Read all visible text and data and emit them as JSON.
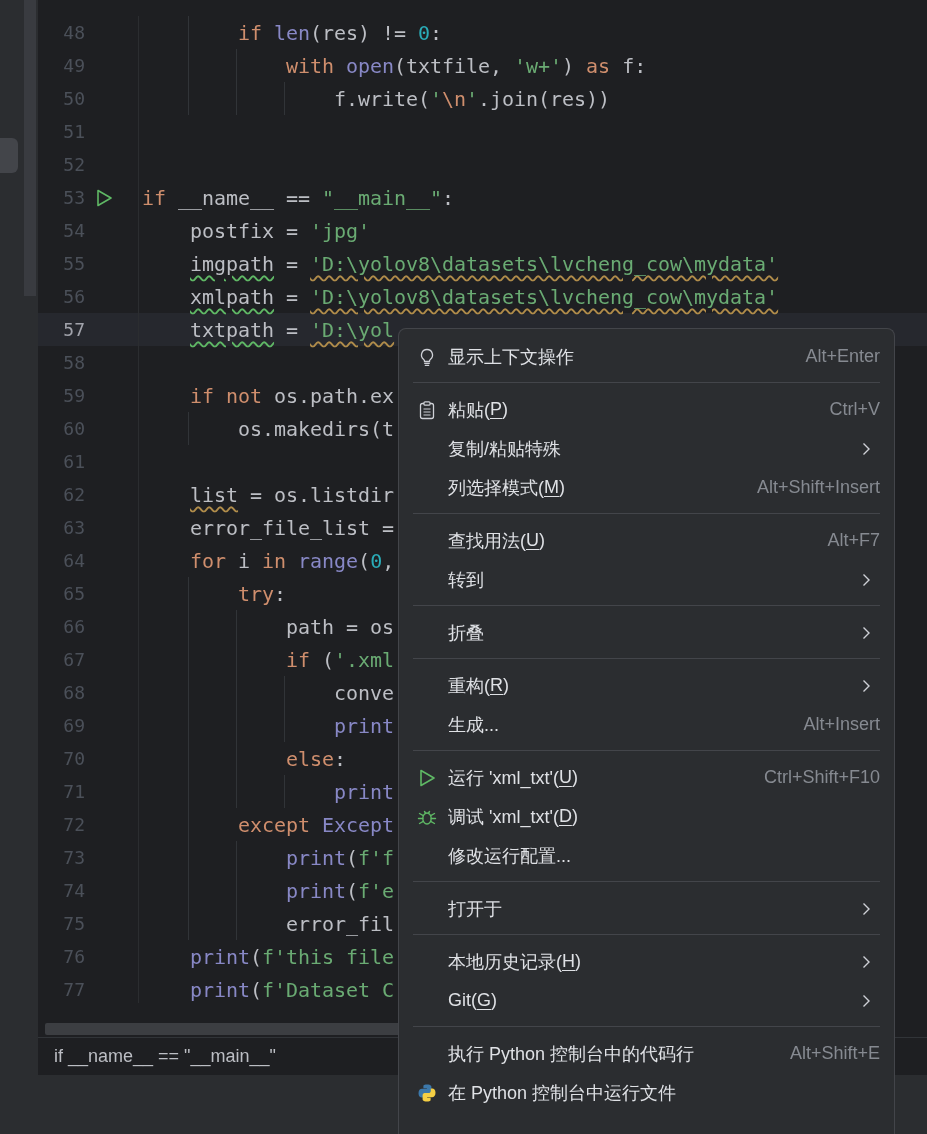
{
  "editor": {
    "lines": [
      {
        "number": "48",
        "current": false,
        "run_marker": false,
        "segments": [
          {
            "text": "        if",
            "kind": "keyword"
          },
          {
            "text": " len",
            "kind": "builtin"
          },
          {
            "text": "(res) != ",
            "kind": "plain"
          },
          {
            "text": "0",
            "kind": "number"
          },
          {
            "text": ":",
            "kind": "plain"
          }
        ]
      },
      {
        "number": "49",
        "current": false,
        "run_marker": false,
        "segments": [
          {
            "text": "            with",
            "kind": "keyword"
          },
          {
            "text": " open",
            "kind": "builtin"
          },
          {
            "text": "(txtfile, ",
            "kind": "plain"
          },
          {
            "text": "'w+'",
            "kind": "string"
          },
          {
            "text": ") ",
            "kind": "plain"
          },
          {
            "text": "as",
            "kind": "keyword"
          },
          {
            "text": " f:",
            "kind": "plain"
          }
        ]
      },
      {
        "number": "50",
        "current": false,
        "run_marker": false,
        "segments": [
          {
            "text": "                f.write(",
            "kind": "plain"
          },
          {
            "text": "'",
            "kind": "string"
          },
          {
            "text": "\\n",
            "kind": "escape"
          },
          {
            "text": "'",
            "kind": "string"
          },
          {
            "text": ".join(res))",
            "kind": "plain"
          }
        ]
      },
      {
        "number": "51",
        "current": false,
        "run_marker": false
      },
      {
        "number": "52",
        "current": false,
        "run_marker": false
      },
      {
        "number": "53",
        "current": false,
        "run_marker": true,
        "segments": [
          {
            "text": "if",
            "kind": "keyword"
          },
          {
            "text": " __name__ == ",
            "kind": "plain"
          },
          {
            "text": "\"__main__\"",
            "kind": "string"
          },
          {
            "text": ":",
            "kind": "plain"
          }
        ]
      },
      {
        "number": "54",
        "current": false,
        "run_marker": false,
        "segments": [
          {
            "text": "    postfix = ",
            "kind": "plain"
          },
          {
            "text": "'jpg'",
            "kind": "string"
          }
        ]
      },
      {
        "number": "55",
        "current": false,
        "run_marker": false,
        "segments": [
          {
            "text": "    imgpath",
            "kind": "typo"
          },
          {
            "text": " = ",
            "kind": "plain"
          },
          {
            "text": "'D:\\yolov8\\datasets\\lvcheng_cow\\mydata'",
            "kind": "warnstring"
          }
        ]
      },
      {
        "number": "56",
        "current": false,
        "run_marker": false,
        "segments": [
          {
            "text": "    xmlpath",
            "kind": "typo"
          },
          {
            "text": " = ",
            "kind": "plain"
          },
          {
            "text": "'D:\\yolov8\\datasets\\lvcheng_cow\\mydata'",
            "kind": "warnstring"
          }
        ]
      },
      {
        "number": "57",
        "current": true,
        "run_marker": false,
        "segments": [
          {
            "text": "    txtpath",
            "kind": "typo"
          },
          {
            "text": " = ",
            "kind": "plain"
          },
          {
            "text": "'D:\\yol",
            "kind": "warnstring"
          }
        ]
      },
      {
        "number": "58",
        "current": false,
        "run_marker": false
      },
      {
        "number": "59",
        "current": false,
        "run_marker": false,
        "segments": [
          {
            "text": "    if not",
            "kind": "keyword"
          },
          {
            "text": " os.path.ex",
            "kind": "plain"
          }
        ]
      },
      {
        "number": "60",
        "current": false,
        "run_marker": false,
        "segments": [
          {
            "text": "        os.makedirs(t",
            "kind": "plain"
          }
        ]
      },
      {
        "number": "61",
        "current": false,
        "run_marker": false
      },
      {
        "number": "62",
        "current": false,
        "run_marker": false,
        "segments": [
          {
            "text": "    list",
            "kind": "warnname"
          },
          {
            "text": " = os.listdir",
            "kind": "plain"
          }
        ]
      },
      {
        "number": "63",
        "current": false,
        "run_marker": false,
        "segments": [
          {
            "text": "    error_file_list =",
            "kind": "plain"
          }
        ]
      },
      {
        "number": "64",
        "current": false,
        "run_marker": false,
        "segments": [
          {
            "text": "    for",
            "kind": "keyword"
          },
          {
            "text": " i ",
            "kind": "plain"
          },
          {
            "text": "in",
            "kind": "keyword"
          },
          {
            "text": " range",
            "kind": "builtin"
          },
          {
            "text": "(",
            "kind": "plain"
          },
          {
            "text": "0",
            "kind": "number"
          },
          {
            "text": ",",
            "kind": "plain"
          }
        ]
      },
      {
        "number": "65",
        "current": false,
        "run_marker": false,
        "segments": [
          {
            "text": "        try",
            "kind": "keyword"
          },
          {
            "text": ":",
            "kind": "plain"
          }
        ]
      },
      {
        "number": "66",
        "current": false,
        "run_marker": false,
        "segments": [
          {
            "text": "            path = os",
            "kind": "plain"
          }
        ]
      },
      {
        "number": "67",
        "current": false,
        "run_marker": false,
        "segments": [
          {
            "text": "            if",
            "kind": "keyword"
          },
          {
            "text": " (",
            "kind": "plain"
          },
          {
            "text": "'.xml",
            "kind": "string"
          }
        ]
      },
      {
        "number": "68",
        "current": false,
        "run_marker": false,
        "segments": [
          {
            "text": "                conve",
            "kind": "plain"
          }
        ]
      },
      {
        "number": "69",
        "current": false,
        "run_marker": false,
        "segments": [
          {
            "text": "                print",
            "kind": "builtin"
          }
        ]
      },
      {
        "number": "70",
        "current": false,
        "run_marker": false,
        "segments": [
          {
            "text": "            else",
            "kind": "keyword"
          },
          {
            "text": ":",
            "kind": "plain"
          }
        ]
      },
      {
        "number": "71",
        "current": false,
        "run_marker": false,
        "segments": [
          {
            "text": "                print",
            "kind": "builtin"
          }
        ]
      },
      {
        "number": "72",
        "current": false,
        "run_marker": false,
        "segments": [
          {
            "text": "        except",
            "kind": "keyword"
          },
          {
            "text": " Except",
            "kind": "builtin"
          }
        ]
      },
      {
        "number": "73",
        "current": false,
        "run_marker": false,
        "segments": [
          {
            "text": "            print",
            "kind": "builtin"
          },
          {
            "text": "(",
            "kind": "plain"
          },
          {
            "text": "f'f",
            "kind": "string"
          }
        ]
      },
      {
        "number": "74",
        "current": false,
        "run_marker": false,
        "segments": [
          {
            "text": "            print",
            "kind": "builtin"
          },
          {
            "text": "(",
            "kind": "plain"
          },
          {
            "text": "f'e",
            "kind": "string"
          }
        ]
      },
      {
        "number": "75",
        "current": false,
        "run_marker": false,
        "segments": [
          {
            "text": "            error_fil",
            "kind": "plain"
          }
        ]
      },
      {
        "number": "76",
        "current": false,
        "run_marker": false,
        "segments": [
          {
            "text": "    print",
            "kind": "builtin"
          },
          {
            "text": "(",
            "kind": "plain"
          },
          {
            "text": "f'this file",
            "kind": "string"
          }
        ]
      },
      {
        "number": "77",
        "current": false,
        "run_marker": false,
        "segments": [
          {
            "text": "    print",
            "kind": "builtin"
          },
          {
            "text": "(",
            "kind": "plain"
          },
          {
            "text": "f'Dataset C",
            "kind": "string"
          }
        ]
      }
    ]
  },
  "breadcrumb": "if __name__ == \"__main__\"",
  "context_menu": {
    "items": [
      {
        "kind": "hint",
        "label": "显示上下文操作",
        "shortcut": "Alt+Enter",
        "submenu": false
      },
      {
        "kind": "separator"
      },
      {
        "kind": "paste",
        "label": "粘贴(",
        "mnemonic": "P",
        "label_end": ")",
        "shortcut": "Ctrl+V",
        "submenu": false
      },
      {
        "kind": "plain",
        "label": "复制/粘贴特殊",
        "submenu": true
      },
      {
        "kind": "plain",
        "label": "列选择模式(",
        "mnemonic": "M",
        "label_end": ")",
        "shortcut": "Alt+Shift+Insert",
        "submenu": false
      },
      {
        "kind": "separator"
      },
      {
        "kind": "plain",
        "label": "查找用法(",
        "mnemonic": "U",
        "label_end": ")",
        "shortcut": "Alt+F7",
        "submenu": false
      },
      {
        "kind": "plain",
        "label": "转到",
        "submenu": true
      },
      {
        "kind": "separator"
      },
      {
        "kind": "plain",
        "label": "折叠",
        "submenu": true
      },
      {
        "kind": "separator"
      },
      {
        "kind": "plain",
        "label": "重构(",
        "mnemonic": "R",
        "label_end": ")",
        "submenu": true
      },
      {
        "kind": "plain",
        "label": "生成...",
        "shortcut": "Alt+Insert",
        "submenu": false
      },
      {
        "kind": "separator"
      },
      {
        "kind": "run",
        "label": "运行 'xml_txt'(",
        "mnemonic": "U",
        "label_end": ")",
        "shortcut": "Ctrl+Shift+F10",
        "submenu": false
      },
      {
        "kind": "debug",
        "label": "调试 'xml_txt'(",
        "mnemonic": "D",
        "label_end": ")",
        "submenu": false
      },
      {
        "kind": "plain",
        "label": "修改运行配置...",
        "submenu": false
      },
      {
        "kind": "separator"
      },
      {
        "kind": "plain",
        "label": "打开于",
        "submenu": true
      },
      {
        "kind": "separator"
      },
      {
        "kind": "plain",
        "label": "本地历史记录(",
        "mnemonic": "H",
        "label_end": ")",
        "submenu": true
      },
      {
        "kind": "plain",
        "label": "Git(",
        "mnemonic": "G",
        "label_end": ")",
        "submenu": true
      },
      {
        "kind": "separator"
      },
      {
        "kind": "plain",
        "label": "执行 Python 控制台中的代码行",
        "shortcut": "Alt+Shift+E",
        "submenu": false
      },
      {
        "kind": "python",
        "label": "在 Python 控制台中运行文件",
        "submenu": false
      }
    ]
  }
}
